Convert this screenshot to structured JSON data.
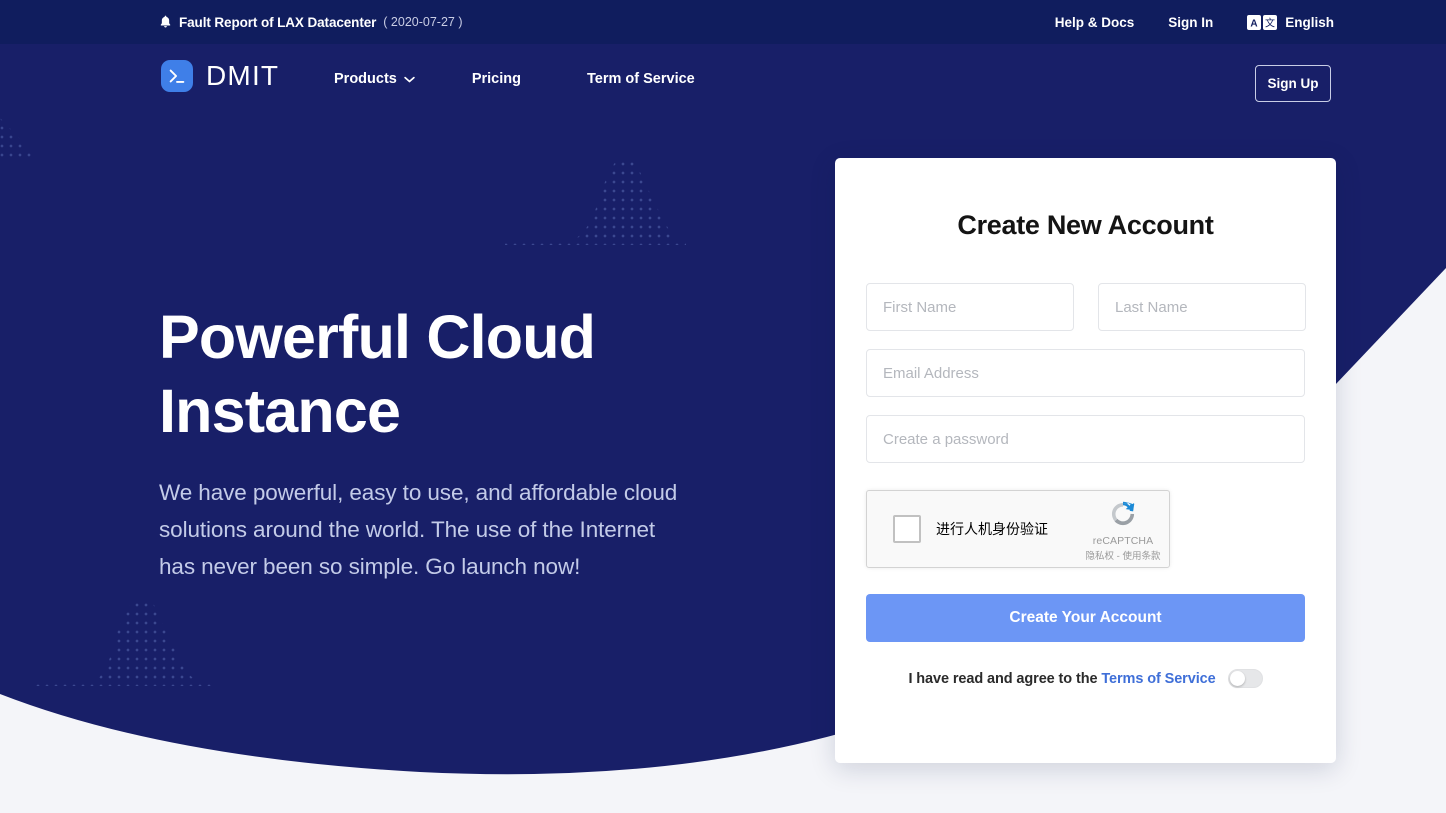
{
  "colors": {
    "navy_deep": "#101d5e",
    "navy_hero": "#181f68",
    "page_bg": "#f4f5f9",
    "accent_blue": "#6c96f5",
    "brand_blue": "#3f7fe8",
    "link_blue": "#3f6fd8"
  },
  "topbar": {
    "bell_icon": "bell-icon",
    "fault_title": "Fault Report of LAX Datacenter",
    "fault_date": "( 2020-07-27 )",
    "help_docs": "Help & Docs",
    "sign_in": "Sign In",
    "language_icon": "translate-icon",
    "language": "English"
  },
  "nav": {
    "logo_icon": "terminal-prompt-icon",
    "brand": "DMIT",
    "links": [
      {
        "label": "Products",
        "has_chevron": true,
        "icon": "chevron-down-icon"
      },
      {
        "label": "Pricing",
        "has_chevron": false
      },
      {
        "label": "Term of Service",
        "has_chevron": false
      }
    ],
    "signup": "Sign Up"
  },
  "hero": {
    "title": "Powerful Cloud Instance",
    "subtitle": "We have powerful, easy to use, and affordable cloud solutions around the world. The use of the Internet has never been so simple. Go launch now!"
  },
  "signup_card": {
    "title": "Create New Account",
    "first_name": {
      "value": "",
      "placeholder": "First Name"
    },
    "last_name": {
      "value": "",
      "placeholder": "Last Name"
    },
    "email": {
      "value": "",
      "placeholder": "Email Address"
    },
    "password": {
      "value": "",
      "placeholder": "Create a password"
    },
    "recaptcha": {
      "checkbox_icon": "recaptcha-checkbox",
      "label": "进行人机身份验证",
      "logo_icon": "recaptcha-logo-icon",
      "brand": "reCAPTCHA",
      "legal": "隐私权 - 使用条款"
    },
    "submit": "Create Your Account",
    "terms_prefix": "I have read and agree to the",
    "terms_link": "Terms of Service",
    "terms_toggle": "off"
  }
}
